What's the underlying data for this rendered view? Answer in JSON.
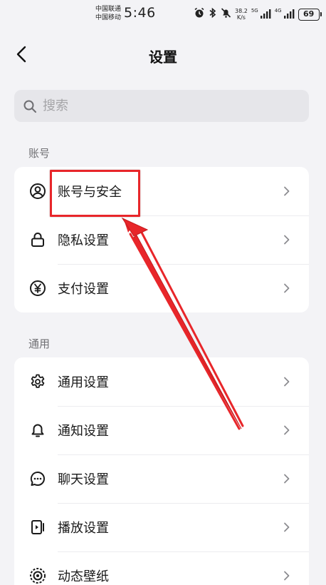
{
  "status_bar": {
    "carrier_1": "中国联通",
    "carrier_2": "中国移动",
    "time": "5:46",
    "speed_value": "38.2",
    "speed_unit": "K/s",
    "network_1": "5G",
    "network_2": "4G",
    "battery": "69"
  },
  "header": {
    "title": "设置",
    "back_icon": "chevron-left-icon"
  },
  "search": {
    "placeholder": "搜索",
    "icon": "search-icon"
  },
  "sections": [
    {
      "label": "账号",
      "items": [
        {
          "label": "账号与安全",
          "icon": "user-circle-icon"
        },
        {
          "label": "隐私设置",
          "icon": "lock-icon"
        },
        {
          "label": "支付设置",
          "icon": "yuan-icon"
        }
      ]
    },
    {
      "label": "通用",
      "items": [
        {
          "label": "通用设置",
          "icon": "gear-icon"
        },
        {
          "label": "通知设置",
          "icon": "bell-icon"
        },
        {
          "label": "聊天设置",
          "icon": "chat-bubble-icon"
        },
        {
          "label": "播放设置",
          "icon": "play-icon"
        },
        {
          "label": "动态壁纸",
          "icon": "wallpaper-icon"
        }
      ]
    }
  ],
  "annotation": {
    "color": "#e8262a",
    "target": "账号与安全"
  }
}
